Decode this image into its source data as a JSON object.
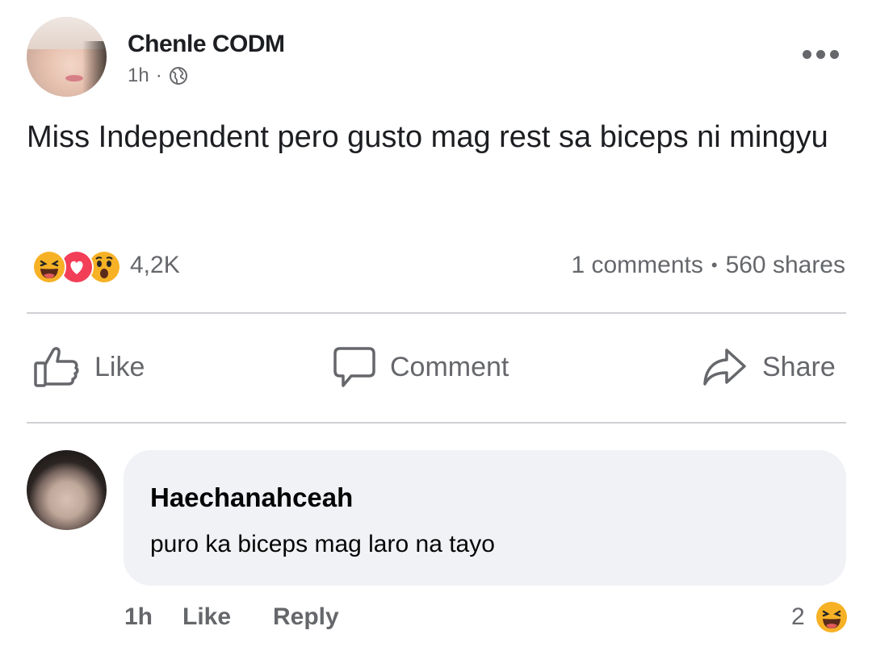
{
  "post": {
    "author": "Chenle CODM",
    "time": "1h",
    "meta_sep": "·",
    "privacy_icon": "globe-icon",
    "text": "Miss Independent pero gusto mag rest sa biceps ni mingyu"
  },
  "reactions": {
    "icons": [
      "haha-icon",
      "love-icon",
      "wow-icon"
    ],
    "count": "4,2K",
    "comments": "1 comments",
    "sep": "•",
    "shares": "560 shares"
  },
  "actions": {
    "like": "Like",
    "comment": "Comment",
    "share": "Share"
  },
  "comment": {
    "name": "Haechanahceah",
    "text": "puro ka biceps mag laro na tayo",
    "time": "1h",
    "like": "Like",
    "reply": "Reply",
    "reaction_count": "2",
    "reaction_icon": "haha-icon"
  },
  "colors": {
    "secondary_text": "#65676b",
    "divider": "#ced0d4",
    "bubble": "#f0f2f5",
    "love": "#f33e58",
    "emoji_yellow": "#f7b125"
  }
}
